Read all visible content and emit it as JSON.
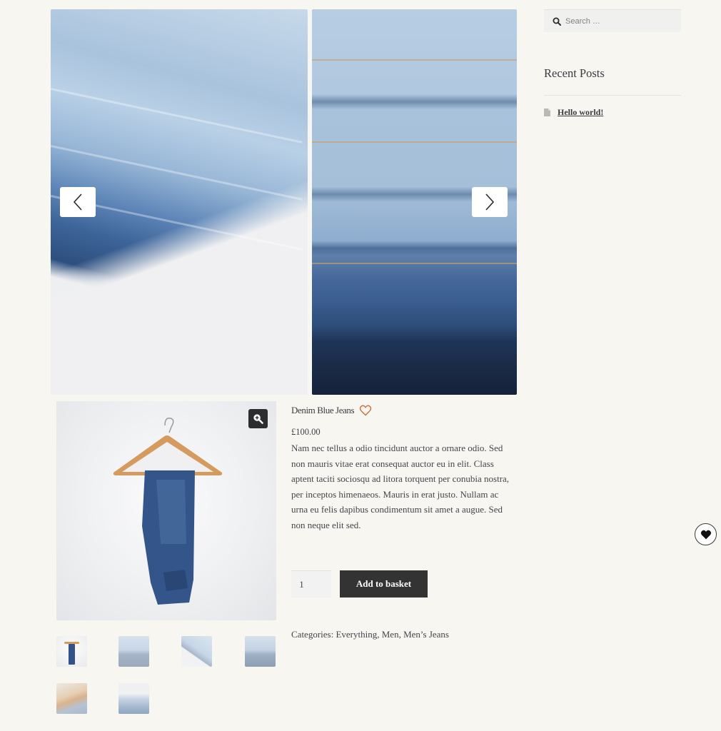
{
  "slider": {
    "slides": [
      {
        "alt": "Stack of light and dark denim jeans"
      },
      {
        "alt": "Close-up of folded denim jeans pockets"
      }
    ],
    "prev_icon": "chevron-left-icon",
    "next_icon": "chevron-right-icon"
  },
  "gallery": {
    "main_image_alt": "Denim jeans hanging on a wooden hanger",
    "zoom_icon": "magnifier-plus-icon",
    "thumbnails": [
      {
        "alt": "Jeans on hanger"
      },
      {
        "alt": "Folded jeans stack"
      },
      {
        "alt": "Jeans diagonal"
      },
      {
        "alt": "Folded jeans pockets"
      },
      {
        "alt": "Person wearing jeans"
      },
      {
        "alt": "Folded jeans pile"
      }
    ]
  },
  "product": {
    "title": "Denim Blue Jeans",
    "wishlist_icon": "heart-outline-icon",
    "price": "£100.00",
    "description": "Nam nec tellus a odio tincidunt auctor a ornare odio. Sed non mauris vitae erat consequat auctor eu in elit. Class aptent taciti sociosqu ad litora torquent per conubia nostra, per inceptos himenaeos. Mauris in erat justo. Nullam ac urna eu felis dapibus condimentum sit amet a augue. Sed non neque elit sed.",
    "quantity": "1",
    "add_to_basket_label": "Add to basket",
    "categories_label": "Categories:",
    "categories": [
      "Everything",
      "Men",
      "Men’s Jeans"
    ]
  },
  "sidebar": {
    "search_placeholder": "Search …",
    "recent_posts_title": "Recent Posts",
    "recent_posts": [
      {
        "title": "Hello world!"
      }
    ]
  },
  "floating_wishlist": {
    "icon": "heart-filled-icon"
  },
  "colors": {
    "background": "#f8f6f1",
    "button_dark": "#333333",
    "wishlist_accent": "#c9763e"
  }
}
